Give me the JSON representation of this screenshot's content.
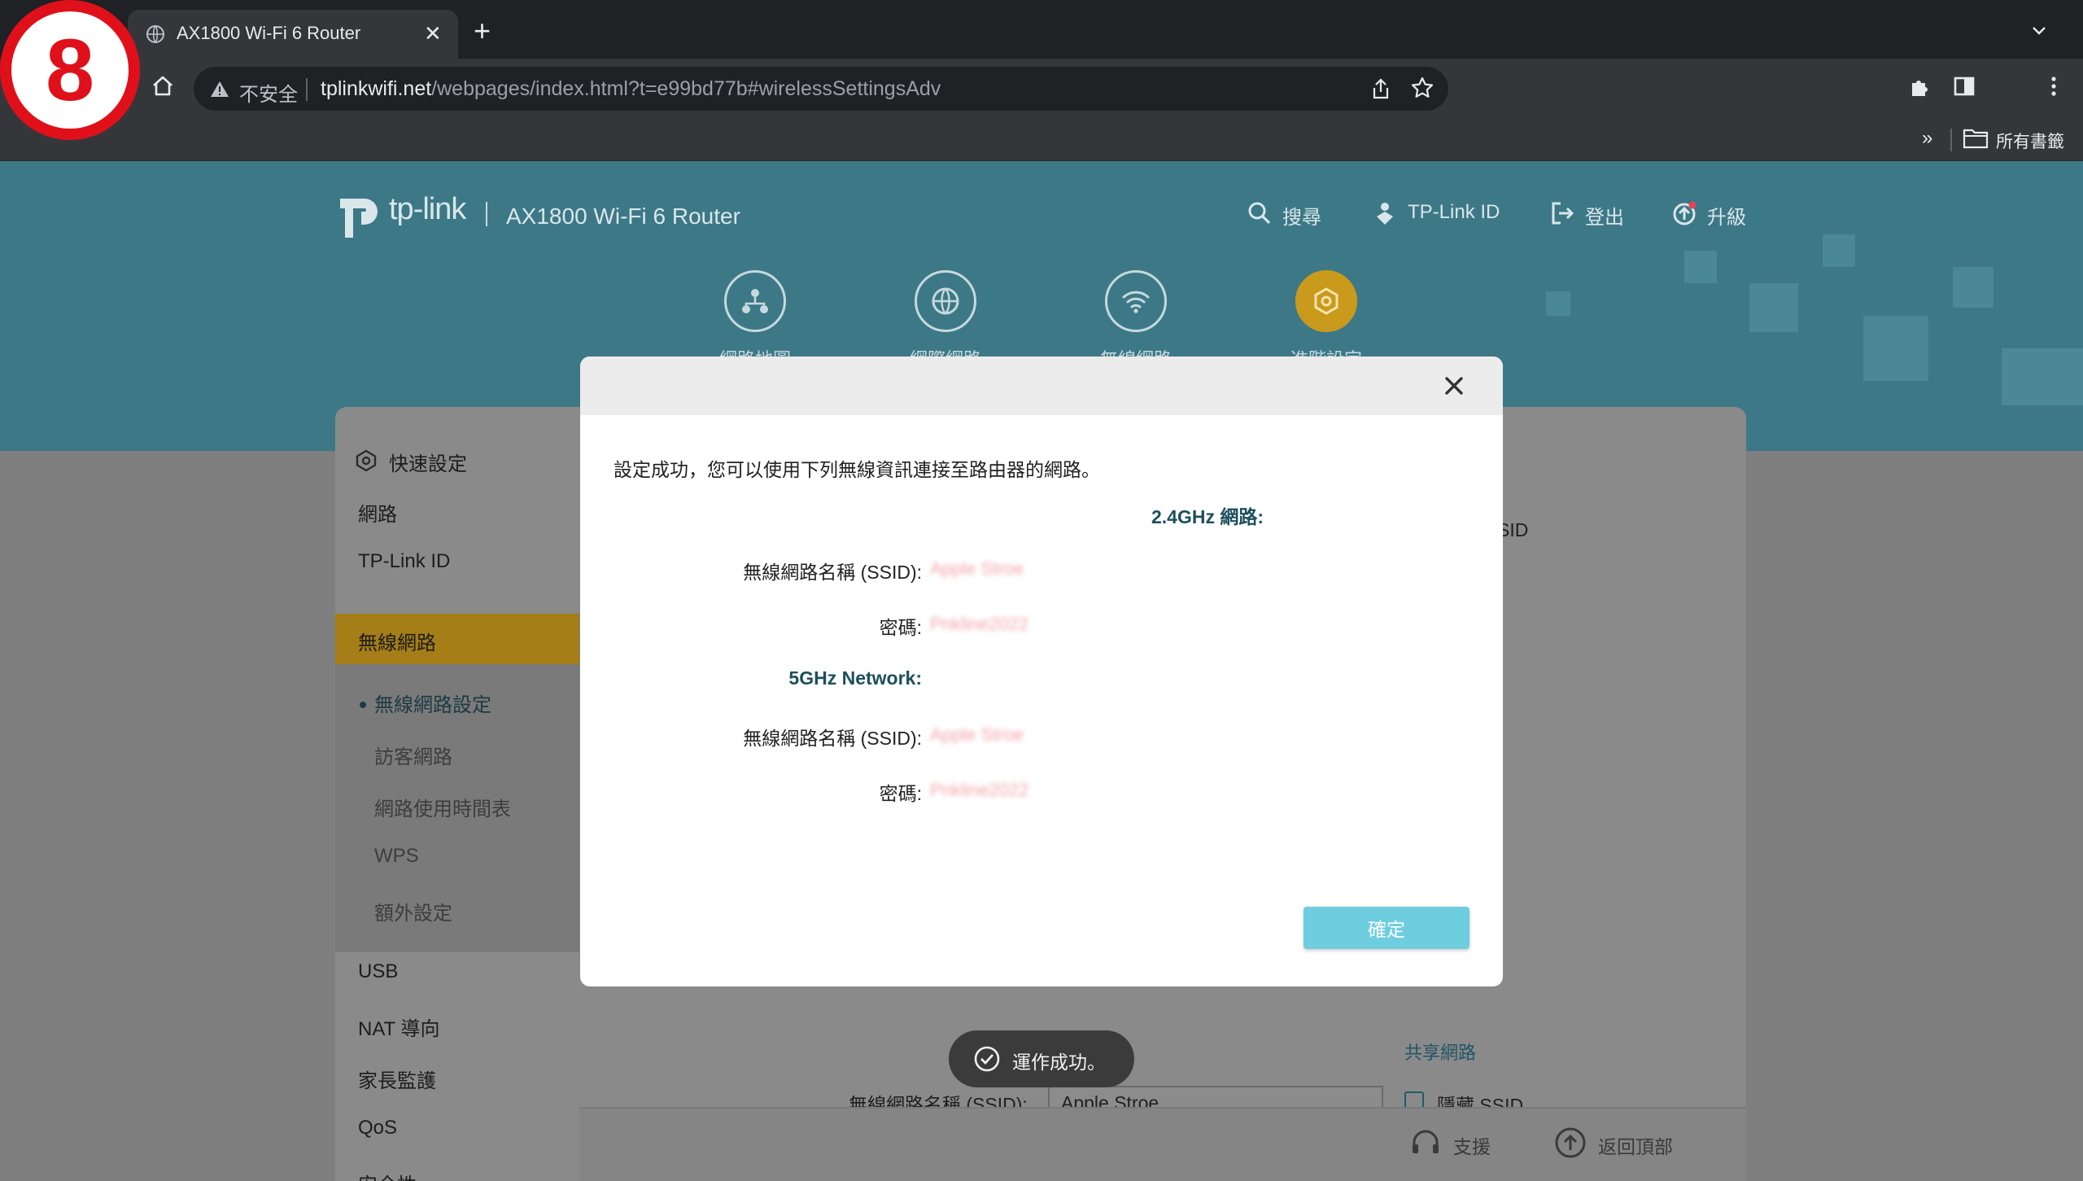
{
  "browser": {
    "tab_title": "AX1800 Wi-Fi 6 Router",
    "tab_close": "✕",
    "new_tab": "+",
    "insecure_label": "不安全",
    "url_host": "tplinkwifi.net",
    "url_path": "/webpages/index.html?t=e99bd77b#wirelessSettingsAdv",
    "bookmarks_overflow": "»",
    "bookmarks_folder": "所有書籤"
  },
  "step_badge": "8",
  "header": {
    "logo_word": "tp-link",
    "model": "AX1800 Wi-Fi 6 Router",
    "search": "搜尋",
    "tplink_id": "TP-Link ID",
    "logout": "登出",
    "upgrade": "升級"
  },
  "main_nav": [
    {
      "label": "網路地圖",
      "icon": "network-map-icon"
    },
    {
      "label": "網際網路",
      "icon": "globe-icon"
    },
    {
      "label": "無線網路",
      "icon": "wifi-icon"
    },
    {
      "label": "進階設定",
      "icon": "gear-icon",
      "active": true
    }
  ],
  "sidebar": {
    "quick_setup": "快速設定",
    "network": "網路",
    "tplink_id": "TP-Link ID",
    "wireless": "無線網路",
    "sub_items": [
      "無線網路設定",
      "訪客網路",
      "網路使用時間表",
      "WPS",
      "額外設定"
    ],
    "usb": "USB",
    "nat": "NAT 導向",
    "parental": "家長監護",
    "qos": "QoS",
    "security": "安全性"
  },
  "background_form": {
    "ssid_fragment": "SID",
    "ssid_label": "無線網路名稱 (SSID):",
    "ssid_value": "Apple Stroe",
    "share_link": "共享網路",
    "hide_ssid": "隱藏 SSID"
  },
  "footer": {
    "support": "支援",
    "back_to_top": "返回頂部"
  },
  "toast": "運作成功。",
  "modal": {
    "close": "✕",
    "message": "設定成功，您可以使用下列無線資訊連接至路由器的網路。",
    "band_24": {
      "title": "2.4GHz 網路:",
      "ssid_label": "無線網路名稱 (SSID):",
      "ssid_value": "Apple Stroe",
      "password_label": "密碼:",
      "password_value": "Pnkline2022"
    },
    "band_5": {
      "title": "5GHz Network:",
      "ssid_label": "無線網路名稱 (SSID):",
      "ssid_value": "Apple Stroe",
      "password_label": "密碼:",
      "password_value": "Pnkline2022"
    },
    "confirm": "確定"
  }
}
